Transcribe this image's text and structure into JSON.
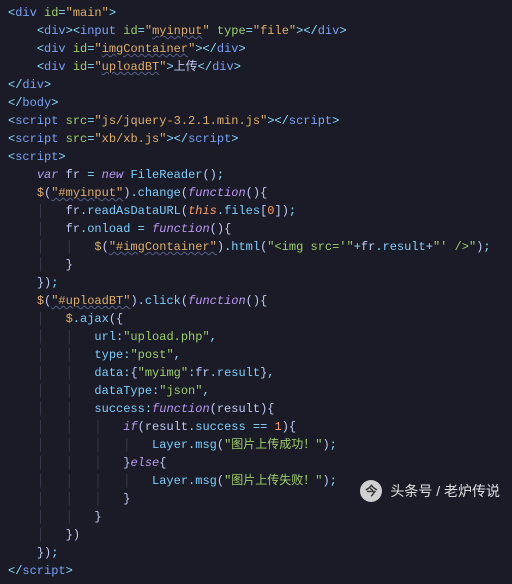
{
  "code": {
    "ids": {
      "main": "main",
      "input": "myinput",
      "imgContainer": "imgContainer",
      "uploadBT": "uploadBT"
    },
    "inputType": "file",
    "uploadText": "上传",
    "scripts": {
      "jquery": "js/jquery-3.2.1.min.js",
      "xb": "xb/xb.js"
    },
    "js": {
      "varDecl": "var",
      "frVar": "fr",
      "newKw": "new",
      "fileReader": "FileReader",
      "selectorInput": "\"#myinput\"",
      "change": "change",
      "functionKw": "function",
      "readAsDataURL": "readAsDataURL",
      "thisKw": "this",
      "files": "files",
      "zero": "0",
      "onload": "onload",
      "selectorContainer": "\"#imgContainer\"",
      "html": "html",
      "imgTagStart": "\"<img",
      "srcAttr": "src='\"",
      "result": "result",
      "imgTagEnd": "\"' />\"",
      "selectorUpload": "\"#uploadBT\"",
      "click": "click",
      "ajax": "ajax",
      "urlKey": "url",
      "urlVal": "\"upload.php\"",
      "typeKey": "type",
      "typeVal": "\"post\"",
      "dataKey": "data",
      "myimgKey": "\"myimg\"",
      "dataTypeKey": "dataType",
      "dataTypeVal": "\"json\"",
      "successKey": "success",
      "resultParam": "result",
      "ifKw": "if",
      "successProp": "success",
      "one": "1",
      "layer": "Layer",
      "msg": "msg",
      "successMsg": "\"图片上传成功！\"",
      "elseKw": "else",
      "failMsg": "\"图片上传失败！\""
    }
  },
  "watermark": {
    "label": "头条号 / 老炉传说"
  }
}
